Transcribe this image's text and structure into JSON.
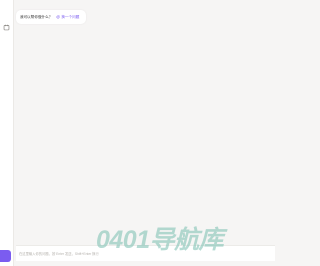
{
  "sidebar": {
    "top_icon": "document-icon",
    "new_chat_icon": "new-chat-icon",
    "accent_color": "#7b5cf0"
  },
  "chat": {
    "greeting": "我可以帮你做什么？",
    "greeting_action_icon": "refresh-icon",
    "greeting_action_label": "换一个问题"
  },
  "input": {
    "placeholder": "在这里输入你的问题，按 Enter 发送，Shift+Enter 换行"
  },
  "watermark": {
    "text": "0401导航库"
  }
}
